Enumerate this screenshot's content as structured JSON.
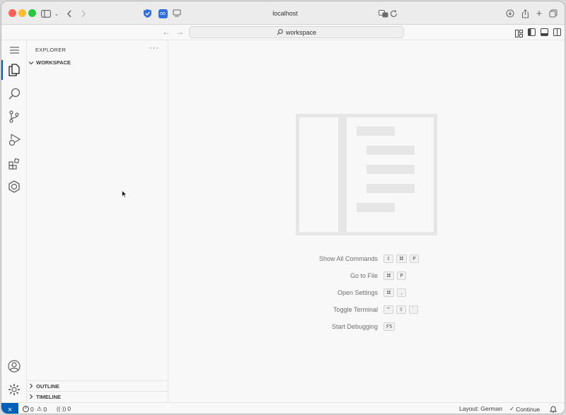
{
  "browser": {
    "url": "localhost"
  },
  "vscode": {
    "command_center": "workspace"
  },
  "sidebar": {
    "title": "EXPLORER",
    "more": "···",
    "workspace": "WORKSPACE",
    "outline": "OUTLINE",
    "timeline": "TIMELINE"
  },
  "editor": {
    "shortcuts": [
      {
        "label": "Show All Commands",
        "keys": [
          "⇧",
          "⌘",
          "P"
        ]
      },
      {
        "label": "Go to File",
        "keys": [
          "⌘",
          "P"
        ]
      },
      {
        "label": "Open Settings",
        "keys": [
          "⌘",
          ","
        ]
      },
      {
        "label": "Toggle Terminal",
        "keys": [
          "^",
          "⇧",
          "`"
        ]
      },
      {
        "label": "Start Debugging",
        "keys": [
          "F5"
        ]
      }
    ]
  },
  "status": {
    "remote": "⨯",
    "errors": "0",
    "warnings": "0",
    "ports": "0",
    "layout": "Layout: German",
    "continue": "Continue"
  },
  "colors": {
    "accent": "#005fb8",
    "watermark": "#e6e6e6"
  }
}
